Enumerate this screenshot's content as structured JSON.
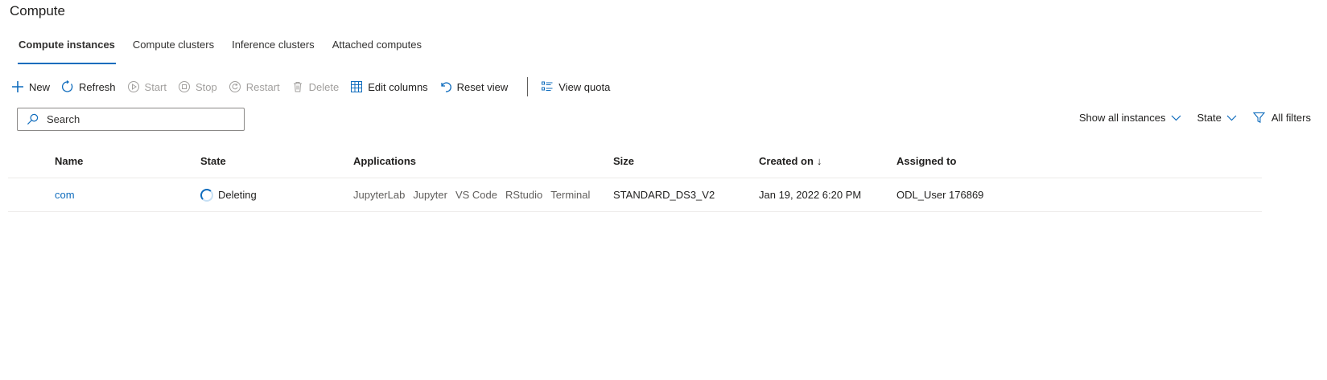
{
  "page": {
    "title": "Compute"
  },
  "tabs": [
    {
      "label": "Compute instances",
      "active": true
    },
    {
      "label": "Compute clusters",
      "active": false
    },
    {
      "label": "Inference clusters",
      "active": false
    },
    {
      "label": "Attached computes",
      "active": false
    }
  ],
  "toolbar": {
    "new_label": "New",
    "refresh_label": "Refresh",
    "start_label": "Start",
    "stop_label": "Stop",
    "restart_label": "Restart",
    "delete_label": "Delete",
    "edit_columns_label": "Edit columns",
    "reset_view_label": "Reset view",
    "view_quota_label": "View quota",
    "icons": [
      "plus-icon",
      "refresh-icon",
      "play-icon",
      "stop-icon",
      "restart-icon",
      "trash-icon",
      "table-columns-icon",
      "undo-icon",
      "list-icon"
    ],
    "accent_color": "#0f6cbd",
    "disabled_color": "#a19f9d"
  },
  "search": {
    "placeholder": "Search",
    "value": ""
  },
  "filters": {
    "show_instances_label": "Show all instances",
    "state_label": "State",
    "all_filters_label": "All filters"
  },
  "table": {
    "columns": {
      "name": "Name",
      "state": "State",
      "applications": "Applications",
      "size": "Size",
      "created_on": "Created on",
      "created_on_sort": "↓",
      "assigned_to": "Assigned to"
    },
    "rows": [
      {
        "name": "com",
        "state": "Deleting",
        "applications": [
          "JupyterLab",
          "Jupyter",
          "VS Code",
          "RStudio",
          "Terminal"
        ],
        "size": "STANDARD_DS3_V2",
        "created_on": "Jan 19, 2022 6:20 PM",
        "assigned_to": "ODL_User 176869"
      }
    ]
  }
}
